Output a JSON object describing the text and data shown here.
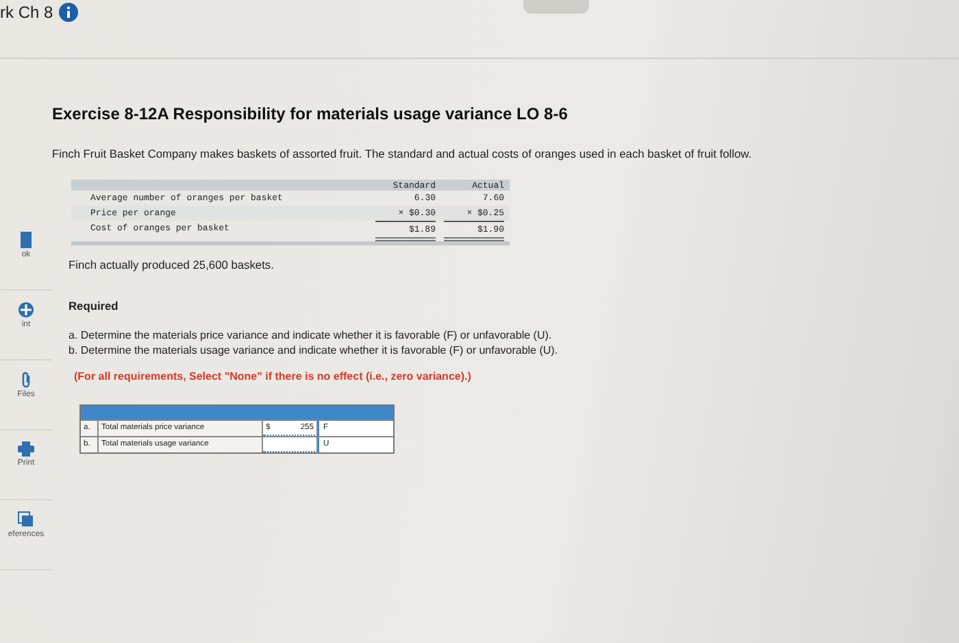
{
  "header": {
    "title": "rk Ch 8"
  },
  "sidebar": {
    "items": [
      {
        "label": "ok",
        "kind": "book"
      },
      {
        "label": "int",
        "kind": "hint"
      },
      {
        "label": "Files",
        "kind": "files"
      },
      {
        "label": "Print",
        "kind": "print"
      },
      {
        "label": "eferences",
        "kind": "references"
      }
    ]
  },
  "exercise": {
    "title": "Exercise 8-12A Responsibility for materials usage variance LO 8-6",
    "intro": "Finch Fruit Basket Company makes baskets of assorted fruit. The standard and actual costs of oranges used in each basket of fruit follow.",
    "data_table": {
      "columns": [
        "Standard",
        "Actual"
      ],
      "rows": [
        {
          "label": "Average number of oranges per basket",
          "values": [
            "6.30",
            "7.60"
          ],
          "kind": "plain"
        },
        {
          "label": "Price per orange",
          "values": [
            "× $0.30",
            "× $0.25"
          ],
          "kind": "multiply"
        },
        {
          "label": "Cost of oranges per basket",
          "values": [
            "$1.89",
            "$1.90"
          ],
          "kind": "total"
        }
      ]
    },
    "production": "Finch actually produced 25,600 baskets.",
    "required_heading": "Required",
    "requirements": [
      "a. Determine the materials price variance and indicate whether it is favorable (F) or unfavorable (U).",
      "b. Determine the materials usage variance and indicate whether it is favorable (F) or unfavorable (U)."
    ],
    "note": "(For all requirements, Select \"None\" if there is no effect (i.e., zero variance).)",
    "answer_table": {
      "rows": [
        {
          "letter": "a.",
          "label": "Total materials price variance",
          "currency": "$",
          "amount": "255",
          "effect": "F"
        },
        {
          "letter": "b.",
          "label": "Total materials usage variance",
          "currency": "",
          "amount": "",
          "effect": "U"
        }
      ]
    }
  }
}
